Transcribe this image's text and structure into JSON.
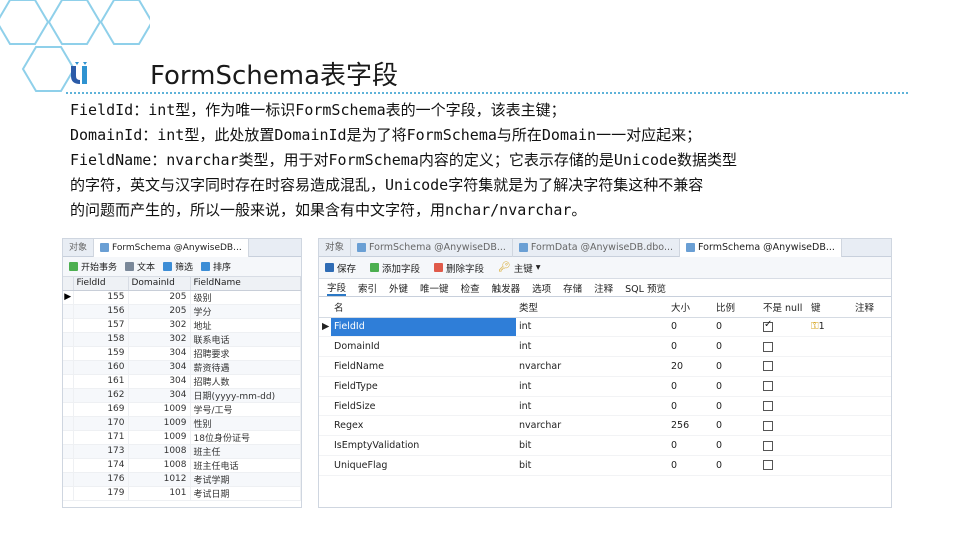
{
  "slide": {
    "title": "FormSchema表字段",
    "lines": [
      "FieldId：int型，作为唯一标识FormSchema表的一个字段，该表主键；",
      "DomainId：int型，此处放置DomainId是为了将FormSchema与所在Domain一一对应起来；",
      "FieldName：nvarchar类型，用于对FormSchema内容的定义；它表示存储的是Unicode数据类型",
      "的字符，英文与汉字同时存在时容易造成混乱，Unicode字符集就是为了解决字符集这种不兼容",
      "的问题而产生的，所以一般来说，如果含有中文字符，用nchar/nvarchar。"
    ]
  },
  "left_panel": {
    "tabs": [
      "对象",
      "FormSchema @AnywiseDB..."
    ],
    "toolbar": [
      "开始事务",
      "文本",
      "筛选",
      "排序"
    ],
    "columns": [
      "FieldId",
      "DomainId",
      "FieldName"
    ],
    "rows": [
      {
        "FieldId": "155",
        "DomainId": "205",
        "FieldName": "级别"
      },
      {
        "FieldId": "156",
        "DomainId": "205",
        "FieldName": "学分"
      },
      {
        "FieldId": "157",
        "DomainId": "302",
        "FieldName": "地址"
      },
      {
        "FieldId": "158",
        "DomainId": "302",
        "FieldName": "联系电话"
      },
      {
        "FieldId": "159",
        "DomainId": "304",
        "FieldName": "招聘要求"
      },
      {
        "FieldId": "160",
        "DomainId": "304",
        "FieldName": "薪资待遇"
      },
      {
        "FieldId": "161",
        "DomainId": "304",
        "FieldName": "招聘人数"
      },
      {
        "FieldId": "162",
        "DomainId": "304",
        "FieldName": "日期(yyyy-mm-dd)"
      },
      {
        "FieldId": "169",
        "DomainId": "1009",
        "FieldName": "学号/工号"
      },
      {
        "FieldId": "170",
        "DomainId": "1009",
        "FieldName": "性别"
      },
      {
        "FieldId": "171",
        "DomainId": "1009",
        "FieldName": "18位身份证号"
      },
      {
        "FieldId": "173",
        "DomainId": "1008",
        "FieldName": "班主任"
      },
      {
        "FieldId": "174",
        "DomainId": "1008",
        "FieldName": "班主任电话"
      },
      {
        "FieldId": "176",
        "DomainId": "1012",
        "FieldName": "考试学期"
      },
      {
        "FieldId": "179",
        "DomainId": "101",
        "FieldName": "考试日期"
      }
    ]
  },
  "right_panel": {
    "tabs": [
      "对象",
      "FormSchema @AnywiseDB...",
      "FormData @AnywiseDB.dbo...",
      "FormSchema @AnywiseDB..."
    ],
    "toolbar": [
      "保存",
      "添加字段",
      "删除字段",
      "主键"
    ],
    "subtabs": [
      "字段",
      "索引",
      "外键",
      "唯一键",
      "检查",
      "触发器",
      "选项",
      "存储",
      "注释",
      "SQL 预览"
    ],
    "columns": [
      "名",
      "类型",
      "大小",
      "比例",
      "不是 null",
      "键",
      "注释"
    ],
    "rows": [
      {
        "name": "FieldId",
        "type": "int",
        "size": "0",
        "scale": "0",
        "not_null": true,
        "key": "1"
      },
      {
        "name": "DomainId",
        "type": "int",
        "size": "0",
        "scale": "0",
        "not_null": false,
        "key": ""
      },
      {
        "name": "FieldName",
        "type": "nvarchar",
        "size": "20",
        "scale": "0",
        "not_null": false,
        "key": ""
      },
      {
        "name": "FieldType",
        "type": "int",
        "size": "0",
        "scale": "0",
        "not_null": false,
        "key": ""
      },
      {
        "name": "FieldSize",
        "type": "int",
        "size": "0",
        "scale": "0",
        "not_null": false,
        "key": ""
      },
      {
        "name": "Regex",
        "type": "nvarchar",
        "size": "256",
        "scale": "0",
        "not_null": false,
        "key": ""
      },
      {
        "name": "IsEmptyValidation",
        "type": "bit",
        "size": "0",
        "scale": "0",
        "not_null": false,
        "key": ""
      },
      {
        "name": "UniqueFlag",
        "type": "bit",
        "size": "0",
        "scale": "0",
        "not_null": false,
        "key": ""
      }
    ]
  },
  "colors": {
    "accent": "#5fb3d9",
    "selection": "#2f7ed8"
  }
}
